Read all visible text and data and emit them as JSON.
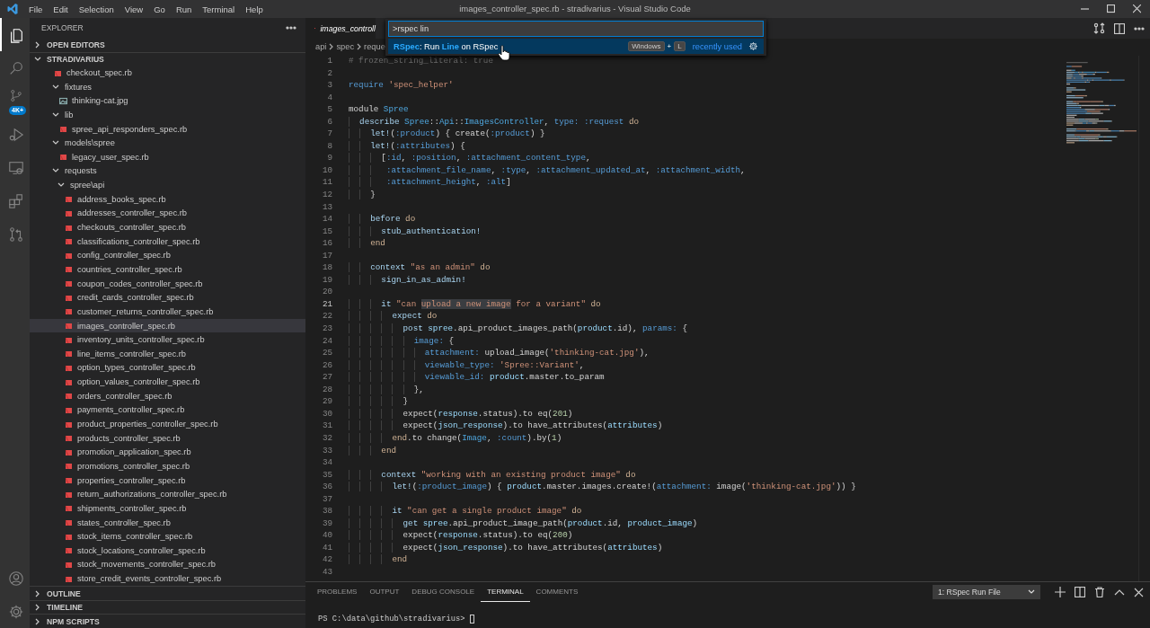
{
  "title_bar": {
    "menu": [
      "File",
      "Edit",
      "Selection",
      "View",
      "Go",
      "Run",
      "Terminal",
      "Help"
    ],
    "title": "images_controller_spec.rb - stradivarius - Visual Studio Code"
  },
  "activity_bar": {
    "items": [
      {
        "kind": "files",
        "selected": true
      },
      {
        "kind": "search",
        "selected": false
      },
      {
        "kind": "source_control",
        "selected": false,
        "badge": "4K+"
      },
      {
        "kind": "run",
        "selected": false
      },
      {
        "kind": "remote",
        "selected": false
      },
      {
        "kind": "extensions",
        "selected": false
      },
      {
        "kind": "pull_requests",
        "selected": false
      }
    ],
    "bottom": [
      {
        "kind": "account"
      },
      {
        "kind": "settings"
      }
    ]
  },
  "sidebar": {
    "title": "EXPLORER",
    "sections": [
      {
        "label": "OPEN EDITORS",
        "expanded": false
      },
      {
        "label": "STRADIVARIUS",
        "expanded": true,
        "tree": [
          {
            "name": "checkout_spec.rb",
            "kind": "ruby",
            "selected": false
          },
          {
            "name": "fixtures",
            "kind": "folder",
            "expanded": true,
            "selected": false,
            "children": [
              {
                "name": "thinking-cat.jpg",
                "kind": "image",
                "selected": false
              }
            ]
          },
          {
            "name": "lib",
            "kind": "folder",
            "expanded": true,
            "selected": false,
            "children": [
              {
                "name": "spree_api_responders_spec.rb",
                "kind": "ruby",
                "selected": false
              }
            ]
          },
          {
            "name": "models\\spree",
            "kind": "folder",
            "expanded": true,
            "selected": false,
            "children": [
              {
                "name": "legacy_user_spec.rb",
                "kind": "ruby",
                "selected": false
              }
            ]
          },
          {
            "name": "requests",
            "kind": "folder",
            "expanded": true,
            "selected": false,
            "children": [
              {
                "name": "spree\\api",
                "kind": "folder",
                "expanded": true,
                "selected": false,
                "children": [
                  {
                    "name": "address_books_spec.rb",
                    "kind": "ruby",
                    "selected": false
                  },
                  {
                    "name": "addresses_controller_spec.rb",
                    "kind": "ruby",
                    "selected": false
                  },
                  {
                    "name": "checkouts_controller_spec.rb",
                    "kind": "ruby",
                    "selected": false
                  },
                  {
                    "name": "classifications_controller_spec.rb",
                    "kind": "ruby",
                    "selected": false
                  },
                  {
                    "name": "config_controller_spec.rb",
                    "kind": "ruby",
                    "selected": false
                  },
                  {
                    "name": "countries_controller_spec.rb",
                    "kind": "ruby",
                    "selected": false
                  },
                  {
                    "name": "coupon_codes_controller_spec.rb",
                    "kind": "ruby",
                    "selected": false
                  },
                  {
                    "name": "credit_cards_controller_spec.rb",
                    "kind": "ruby",
                    "selected": false
                  },
                  {
                    "name": "customer_returns_controller_spec.rb",
                    "kind": "ruby",
                    "selected": false
                  },
                  {
                    "name": "images_controller_spec.rb",
                    "kind": "ruby",
                    "selected": true
                  },
                  {
                    "name": "inventory_units_controller_spec.rb",
                    "kind": "ruby",
                    "selected": false
                  },
                  {
                    "name": "line_items_controller_spec.rb",
                    "kind": "ruby",
                    "selected": false
                  },
                  {
                    "name": "option_types_controller_spec.rb",
                    "kind": "ruby",
                    "selected": false
                  },
                  {
                    "name": "option_values_controller_spec.rb",
                    "kind": "ruby",
                    "selected": false
                  },
                  {
                    "name": "orders_controller_spec.rb",
                    "kind": "ruby",
                    "selected": false
                  },
                  {
                    "name": "payments_controller_spec.rb",
                    "kind": "ruby",
                    "selected": false
                  },
                  {
                    "name": "product_properties_controller_spec.rb",
                    "kind": "ruby",
                    "selected": false
                  },
                  {
                    "name": "products_controller_spec.rb",
                    "kind": "ruby",
                    "selected": false
                  },
                  {
                    "name": "promotion_application_spec.rb",
                    "kind": "ruby",
                    "selected": false
                  },
                  {
                    "name": "promotions_controller_spec.rb",
                    "kind": "ruby",
                    "selected": false
                  },
                  {
                    "name": "properties_controller_spec.rb",
                    "kind": "ruby",
                    "selected": false
                  },
                  {
                    "name": "return_authorizations_controller_spec.rb",
                    "kind": "ruby",
                    "selected": false
                  },
                  {
                    "name": "shipments_controller_spec.rb",
                    "kind": "ruby",
                    "selected": false
                  },
                  {
                    "name": "states_controller_spec.rb",
                    "kind": "ruby",
                    "selected": false
                  },
                  {
                    "name": "stock_items_controller_spec.rb",
                    "kind": "ruby",
                    "selected": false
                  },
                  {
                    "name": "stock_locations_controller_spec.rb",
                    "kind": "ruby",
                    "selected": false
                  },
                  {
                    "name": "stock_movements_controller_spec.rb",
                    "kind": "ruby",
                    "selected": false
                  },
                  {
                    "name": "store_credit_events_controller_spec.rb",
                    "kind": "ruby",
                    "selected": false
                  }
                ]
              }
            ]
          }
        ]
      },
      {
        "label": "OUTLINE",
        "expanded": false
      },
      {
        "label": "TIMELINE",
        "expanded": false
      },
      {
        "label": "NPM SCRIPTS",
        "expanded": false
      }
    ]
  },
  "editor": {
    "tabs": [
      {
        "label": "images_controll",
        "kind": "ruby",
        "selected": true
      }
    ],
    "breadcrumb": [
      "api",
      "spec",
      "reque"
    ],
    "lines": [
      {
        "number": "1",
        "current": false,
        "tokens": [
          {
            "kind": "comment",
            "text": "# frozen_string_literal: true"
          }
        ]
      },
      {
        "number": "2",
        "current": false
      },
      {
        "number": "3",
        "current": false,
        "tokens": [
          {
            "kind": "kw",
            "text": "require"
          },
          {
            "kind": "str",
            "text": " 'spec_helper'"
          }
        ]
      },
      {
        "number": "4",
        "current": false
      },
      {
        "number": "5",
        "current": false,
        "tokens": [
          {
            "kind": "plain",
            "text": "module "
          },
          {
            "kind": "const",
            "text": "Spree"
          }
        ]
      },
      {
        "number": "6",
        "current": false,
        "tokens": [
          {
            "kind": "call",
            "text": "  describe "
          },
          {
            "kind": "const",
            "text": "Spree"
          },
          {
            "kind": "plain",
            "text": "::"
          },
          {
            "kind": "const",
            "text": "Api"
          },
          {
            "kind": "plain",
            "text": "::"
          },
          {
            "kind": "const",
            "text": "ImagesController"
          },
          {
            "kind": "plain",
            "text": ", "
          },
          {
            "kind": "sym",
            "text": "type: :request"
          },
          {
            "kind": "ctrl",
            "text": " do"
          }
        ]
      },
      {
        "number": "7",
        "current": false,
        "tokens": [
          {
            "kind": "call",
            "text": "    let!"
          },
          {
            "kind": "plain",
            "text": "("
          },
          {
            "kind": "sym",
            "text": ":product"
          },
          {
            "kind": "plain",
            "text": ") { create("
          },
          {
            "kind": "sym",
            "text": ":product"
          },
          {
            "kind": "plain",
            "text": ") }"
          }
        ]
      },
      {
        "number": "8",
        "current": false,
        "tokens": [
          {
            "kind": "call",
            "text": "    let!"
          },
          {
            "kind": "plain",
            "text": "("
          },
          {
            "kind": "sym",
            "text": ":attributes"
          },
          {
            "kind": "plain",
            "text": ") {"
          }
        ]
      },
      {
        "number": "9",
        "current": false,
        "tokens": [
          {
            "kind": "plain",
            "text": "      ["
          },
          {
            "kind": "sym",
            "text": ":id"
          },
          {
            "kind": "plain",
            "text": ", "
          },
          {
            "kind": "sym",
            "text": ":position"
          },
          {
            "kind": "plain",
            "text": ", "
          },
          {
            "kind": "sym",
            "text": ":attachment_content_type"
          },
          {
            "kind": "plain",
            "text": ","
          }
        ]
      },
      {
        "number": "10",
        "current": false,
        "tokens": [
          {
            "kind": "sym",
            "text": "       :attachment_file_name"
          },
          {
            "kind": "plain",
            "text": ", "
          },
          {
            "kind": "sym",
            "text": ":type"
          },
          {
            "kind": "plain",
            "text": ", "
          },
          {
            "kind": "sym",
            "text": ":attachment_updated_at"
          },
          {
            "kind": "plain",
            "text": ", "
          },
          {
            "kind": "sym",
            "text": ":attachment_width"
          },
          {
            "kind": "plain",
            "text": ","
          }
        ]
      },
      {
        "number": "11",
        "current": false,
        "tokens": [
          {
            "kind": "sym",
            "text": "       :attachment_height"
          },
          {
            "kind": "plain",
            "text": ", "
          },
          {
            "kind": "sym",
            "text": ":alt"
          },
          {
            "kind": "plain",
            "text": "]"
          }
        ]
      },
      {
        "number": "12",
        "current": false,
        "tokens": [
          {
            "kind": "plain",
            "text": "    }"
          }
        ]
      },
      {
        "number": "13",
        "current": false
      },
      {
        "number": "14",
        "current": false,
        "tokens": [
          {
            "kind": "call",
            "text": "    before"
          },
          {
            "kind": "ctrl",
            "text": " do"
          }
        ]
      },
      {
        "number": "15",
        "current": false,
        "tokens": [
          {
            "kind": "call",
            "text": "      stub_authentication!"
          }
        ]
      },
      {
        "number": "16",
        "current": false,
        "tokens": [
          {
            "kind": "ctrl",
            "text": "    end"
          }
        ]
      },
      {
        "number": "17",
        "current": false
      },
      {
        "number": "18",
        "current": false,
        "tokens": [
          {
            "kind": "call",
            "text": "    context "
          },
          {
            "kind": "str",
            "text": "\"as an admin\""
          },
          {
            "kind": "ctrl",
            "text": " do"
          }
        ]
      },
      {
        "number": "19",
        "current": false,
        "tokens": [
          {
            "kind": "call",
            "text": "      sign_in_as_admin!"
          }
        ]
      },
      {
        "number": "20",
        "current": false
      },
      {
        "number": "21",
        "current": true,
        "tokens": [
          {
            "kind": "call",
            "text": "      it "
          },
          {
            "kind": "str",
            "text": "\"can "
          },
          {
            "kind": "hl",
            "text": "upload a new image"
          },
          {
            "kind": "str",
            "text": " for a variant\""
          },
          {
            "kind": "ctrl",
            "text": " do"
          }
        ]
      },
      {
        "number": "22",
        "current": false,
        "tokens": [
          {
            "kind": "call",
            "text": "        expect"
          },
          {
            "kind": "ctrl",
            "text": " do"
          }
        ]
      },
      {
        "number": "23",
        "current": false,
        "tokens": [
          {
            "kind": "call",
            "text": "          post "
          },
          {
            "kind": "ident",
            "text": "spree"
          },
          {
            "kind": "plain",
            "text": ".api_product_images_path("
          },
          {
            "kind": "ident",
            "text": "product"
          },
          {
            "kind": "plain",
            "text": ".id), "
          },
          {
            "kind": "sym",
            "text": "params:"
          },
          {
            "kind": "plain",
            "text": " {"
          }
        ]
      },
      {
        "number": "24",
        "current": false,
        "tokens": [
          {
            "kind": "sym",
            "text": "            image:"
          },
          {
            "kind": "plain",
            "text": " {"
          }
        ]
      },
      {
        "number": "25",
        "current": false,
        "tokens": [
          {
            "kind": "sym",
            "text": "              attachment:"
          },
          {
            "kind": "plain",
            "text": " upload_image("
          },
          {
            "kind": "str",
            "text": "'thinking-cat.jpg'"
          },
          {
            "kind": "plain",
            "text": "),"
          }
        ]
      },
      {
        "number": "26",
        "current": false,
        "tokens": [
          {
            "kind": "sym",
            "text": "              viewable_type:"
          },
          {
            "kind": "str",
            "text": " 'Spree::Variant'"
          },
          {
            "kind": "plain",
            "text": ","
          }
        ]
      },
      {
        "number": "27",
        "current": false,
        "tokens": [
          {
            "kind": "sym",
            "text": "              viewable_id:"
          },
          {
            "kind": "ident",
            "text": " product"
          },
          {
            "kind": "plain",
            "text": ".master.to_param"
          }
        ]
      },
      {
        "number": "28",
        "current": false,
        "tokens": [
          {
            "kind": "plain",
            "text": "            },"
          }
        ]
      },
      {
        "number": "29",
        "current": false,
        "tokens": [
          {
            "kind": "plain",
            "text": "          }"
          }
        ]
      },
      {
        "number": "30",
        "current": false,
        "tokens": [
          {
            "kind": "plain",
            "text": "          expect("
          },
          {
            "kind": "ident",
            "text": "response"
          },
          {
            "kind": "plain",
            "text": ".status).to eq("
          },
          {
            "kind": "num",
            "text": "201"
          },
          {
            "kind": "plain",
            "text": ")"
          }
        ]
      },
      {
        "number": "31",
        "current": false,
        "tokens": [
          {
            "kind": "plain",
            "text": "          expect("
          },
          {
            "kind": "ident",
            "text": "json_response"
          },
          {
            "kind": "plain",
            "text": ").to have_attributes("
          },
          {
            "kind": "ident",
            "text": "attributes"
          },
          {
            "kind": "plain",
            "text": ")"
          }
        ]
      },
      {
        "number": "32",
        "current": false,
        "tokens": [
          {
            "kind": "ctrl",
            "text": "        end"
          },
          {
            "kind": "plain",
            "text": ".to change("
          },
          {
            "kind": "const",
            "text": "Image"
          },
          {
            "kind": "plain",
            "text": ", "
          },
          {
            "kind": "sym",
            "text": ":count"
          },
          {
            "kind": "plain",
            "text": ").by("
          },
          {
            "kind": "num",
            "text": "1"
          },
          {
            "kind": "plain",
            "text": ")"
          }
        ]
      },
      {
        "number": "33",
        "current": false,
        "tokens": [
          {
            "kind": "ctrl",
            "text": "      end"
          }
        ]
      },
      {
        "number": "34",
        "current": false
      },
      {
        "number": "35",
        "current": false,
        "tokens": [
          {
            "kind": "call",
            "text": "      context "
          },
          {
            "kind": "str",
            "text": "\"working with an existing product image\""
          },
          {
            "kind": "ctrl",
            "text": " do"
          }
        ]
      },
      {
        "number": "36",
        "current": false,
        "tokens": [
          {
            "kind": "call",
            "text": "        let!"
          },
          {
            "kind": "plain",
            "text": "("
          },
          {
            "kind": "sym",
            "text": ":product_image"
          },
          {
            "kind": "plain",
            "text": ") { "
          },
          {
            "kind": "ident",
            "text": "product"
          },
          {
            "kind": "plain",
            "text": ".master.images.create!("
          },
          {
            "kind": "sym",
            "text": "attachment:"
          },
          {
            "kind": "plain",
            "text": " image("
          },
          {
            "kind": "str",
            "text": "'thinking-cat.jpg'"
          },
          {
            "kind": "plain",
            "text": ")) }"
          }
        ]
      },
      {
        "number": "37",
        "current": false
      },
      {
        "number": "38",
        "current": false,
        "tokens": [
          {
            "kind": "call",
            "text": "        it "
          },
          {
            "kind": "str",
            "text": "\"can get a single product image\""
          },
          {
            "kind": "ctrl",
            "text": " do"
          }
        ]
      },
      {
        "number": "39",
        "current": false,
        "tokens": [
          {
            "kind": "call",
            "text": "          get "
          },
          {
            "kind": "ident",
            "text": "spree"
          },
          {
            "kind": "plain",
            "text": ".api_product_image_path("
          },
          {
            "kind": "ident",
            "text": "product"
          },
          {
            "kind": "plain",
            "text": ".id, "
          },
          {
            "kind": "ident",
            "text": "product_image"
          },
          {
            "kind": "plain",
            "text": ")"
          }
        ]
      },
      {
        "number": "40",
        "current": false,
        "tokens": [
          {
            "kind": "plain",
            "text": "          expect("
          },
          {
            "kind": "ident",
            "text": "response"
          },
          {
            "kind": "plain",
            "text": ".status).to eq("
          },
          {
            "kind": "num",
            "text": "200"
          },
          {
            "kind": "plain",
            "text": ")"
          }
        ]
      },
      {
        "number": "41",
        "current": false,
        "tokens": [
          {
            "kind": "plain",
            "text": "          expect("
          },
          {
            "kind": "ident",
            "text": "json_response"
          },
          {
            "kind": "plain",
            "text": ").to have_attributes("
          },
          {
            "kind": "ident",
            "text": "attributes"
          },
          {
            "kind": "plain",
            "text": ")"
          }
        ]
      },
      {
        "number": "42",
        "current": false,
        "tokens": [
          {
            "kind": "ctrl",
            "text": "        end"
          }
        ]
      },
      {
        "number": "43",
        "current": false
      }
    ]
  },
  "command_palette": {
    "value": ">rspec lin",
    "results": [
      {
        "label": "**RSpec**: Run **Line** on RSpec",
        "keys": [
          "Windows",
          "L"
        ],
        "key_joiner": "+",
        "detail": "recently used",
        "selected": true
      }
    ]
  },
  "panel": {
    "tabs": [
      {
        "label": "PROBLEMS",
        "selected": false
      },
      {
        "label": "OUTPUT",
        "selected": false
      },
      {
        "label": "DEBUG CONSOLE",
        "selected": false
      },
      {
        "label": "TERMINAL",
        "selected": true
      },
      {
        "label": "COMMENTS",
        "selected": false
      }
    ],
    "terminal_select": "1: RSpec Run File",
    "prompt": "PS C:\\data\\github\\stradivarius> "
  }
}
